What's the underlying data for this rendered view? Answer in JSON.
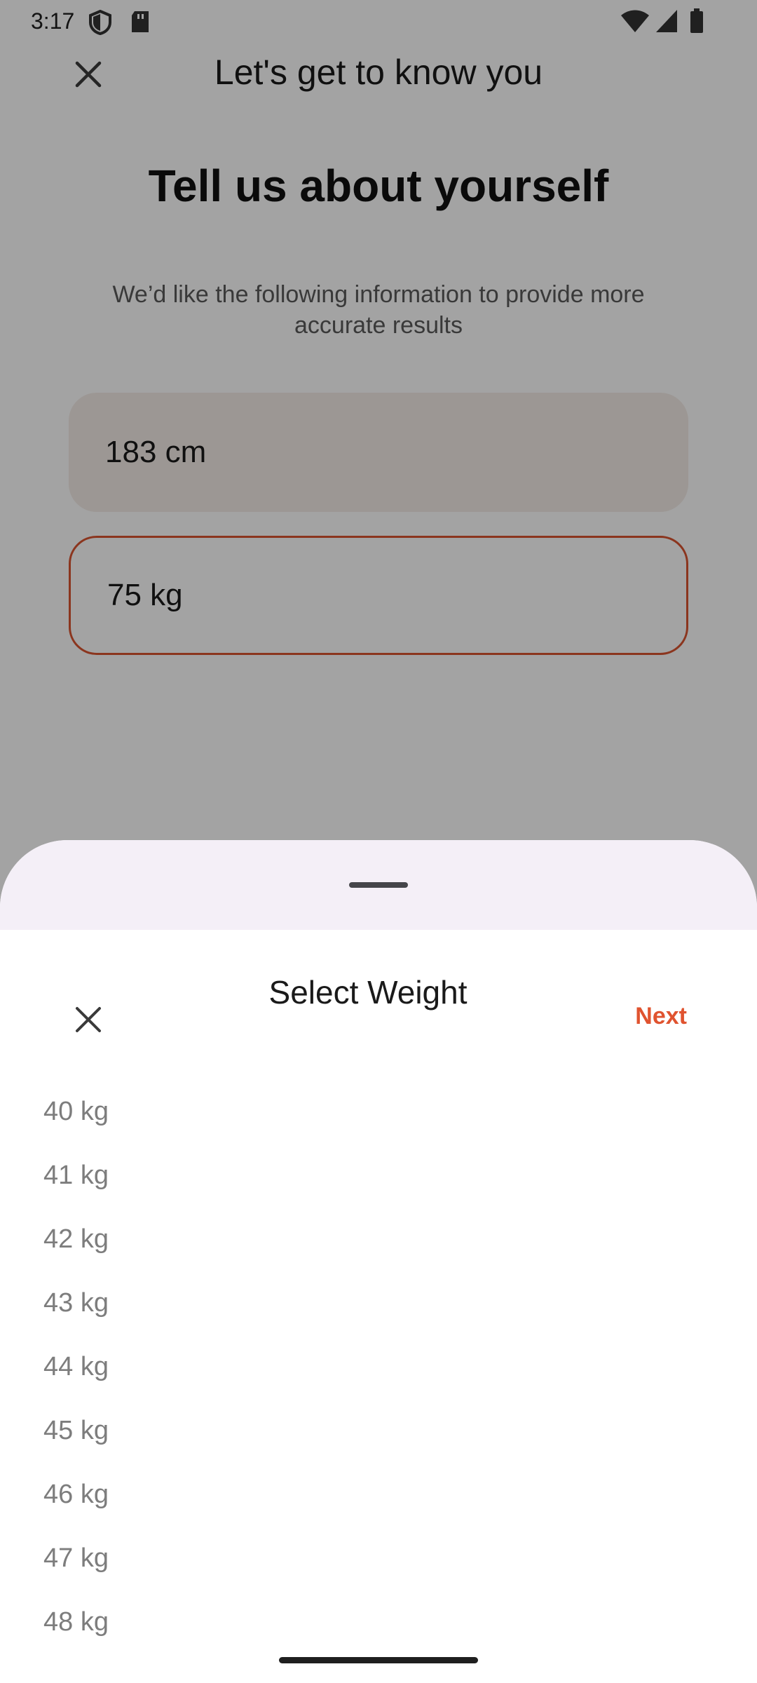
{
  "status_bar": {
    "time": "3:17",
    "icons": [
      "shield-icon",
      "sd-card-icon",
      "wifi-icon",
      "signal-icon",
      "battery-icon"
    ]
  },
  "top_bar": {
    "close_icon": "close-icon",
    "title": "Let's get to know you"
  },
  "content": {
    "heading": "Tell us about yourself",
    "subtitle": "We’d like the following information to provide more accurate results",
    "height_value": "183 cm",
    "weight_value": "75 kg"
  },
  "sheet": {
    "title": "Select Weight",
    "next_label": "Next",
    "options": [
      "40 kg",
      "41 kg",
      "42 kg",
      "43 kg",
      "44 kg",
      "45 kg",
      "46 kg",
      "47 kg",
      "48 kg"
    ]
  },
  "colors": {
    "accent": "#e0532f",
    "sheet_header_bg": "#f4eff7",
    "field_border": "#d9532f"
  }
}
